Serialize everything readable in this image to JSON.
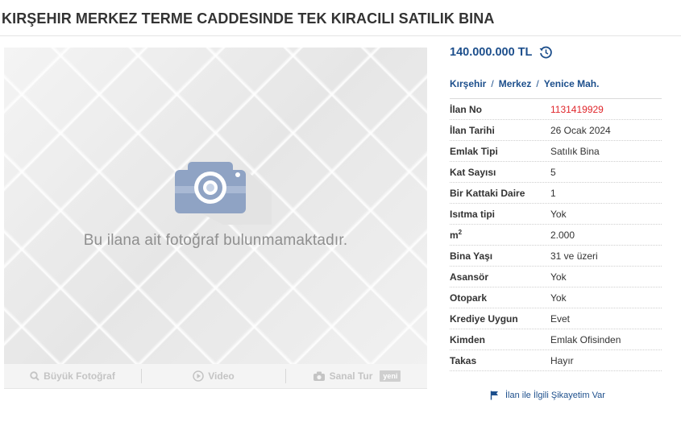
{
  "title": "KIRŞEHIR MERKEZ TERME CADDESINDE TEK KIRACILI SATILIK BINA",
  "photo": {
    "no_photo_text": "Bu ilana ait fotoğraf bulunmamaktadır.",
    "icon": "camera-icon"
  },
  "toolbar": {
    "big_photo": "Büyük Fotoğraf",
    "video": "Video",
    "virtual_tour": "Sanal Tur",
    "new_badge": "yeni"
  },
  "price": {
    "value": "140.000.000 TL",
    "icon": "history-icon"
  },
  "breadcrumb": {
    "city": "Kırşehir",
    "district": "Merkez",
    "neighborhood": "Yenice Mah."
  },
  "details": {
    "ilan_no": {
      "key": "İlan No",
      "value": "1131419929"
    },
    "ilan_tarihi": {
      "key": "İlan Tarihi",
      "value": "26 Ocak 2024"
    },
    "emlak_tipi": {
      "key": "Emlak Tipi",
      "value": "Satılık Bina"
    },
    "kat_sayisi": {
      "key": "Kat Sayısı",
      "value": "5"
    },
    "bir_kattaki_daire": {
      "key": "Bir Kattaki Daire",
      "value": "1"
    },
    "isitma_tipi": {
      "key": "Isıtma tipi",
      "value": "Yok"
    },
    "m2": {
      "key": "m",
      "sup": "2",
      "value": "2.000"
    },
    "bina_yasi": {
      "key": "Bina Yaşı",
      "value": "31 ve üzeri"
    },
    "asansor": {
      "key": "Asansör",
      "value": "Yok"
    },
    "otopark": {
      "key": "Otopark",
      "value": "Yok"
    },
    "krediye_uygun": {
      "key": "Krediye Uygun",
      "value": "Evet"
    },
    "kimden": {
      "key": "Kimden",
      "value": "Emlak Ofisinden"
    },
    "takas": {
      "key": "Takas",
      "value": "Hayır"
    }
  },
  "complaint": {
    "label": "İlan ile İlgili Şikayetim Var",
    "icon": "flag-icon"
  },
  "colors": {
    "link_blue": "#1d4f8c",
    "ilan_no_red": "#e0262b",
    "camera_blue": "#8fa3c4"
  }
}
